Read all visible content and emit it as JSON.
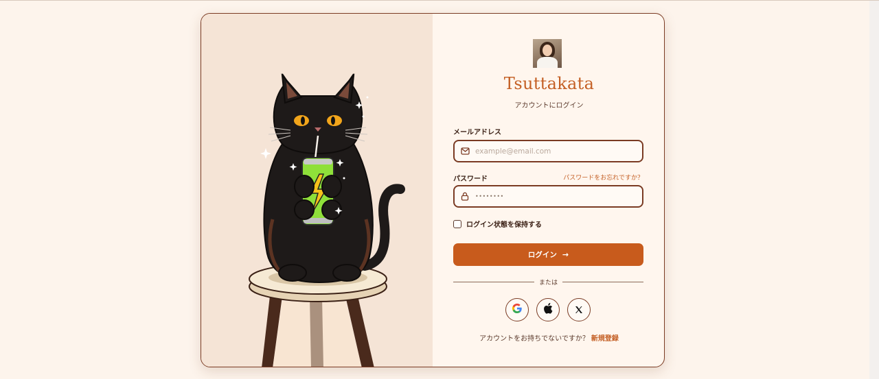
{
  "brand": {
    "name": "Tsuttakata",
    "subtitle": "アカウントにログイン"
  },
  "form": {
    "email_label": "メールアドレス",
    "email_placeholder": "example@email.com",
    "password_label": "パスワード",
    "password_value": "••••••••",
    "forgot_link": "パスワードをお忘れですか？",
    "remember_label": "ログイン状態を保持する",
    "remember_checked": false,
    "submit_label": "ログイン",
    "submit_icon": "arrow-right-icon"
  },
  "divider": {
    "text": "または"
  },
  "social": [
    {
      "name": "google",
      "icon": "google-icon"
    },
    {
      "name": "apple",
      "icon": "apple-icon"
    },
    {
      "name": "x",
      "icon": "x-icon"
    }
  ],
  "footer": {
    "prompt": "アカウントをお持ちでないですか？",
    "signup_link": "新規登録"
  },
  "colors": {
    "accent": "#c85b1c",
    "border": "#7a3a22",
    "background": "#fdf4ec",
    "panel": "#f5e4d6"
  }
}
